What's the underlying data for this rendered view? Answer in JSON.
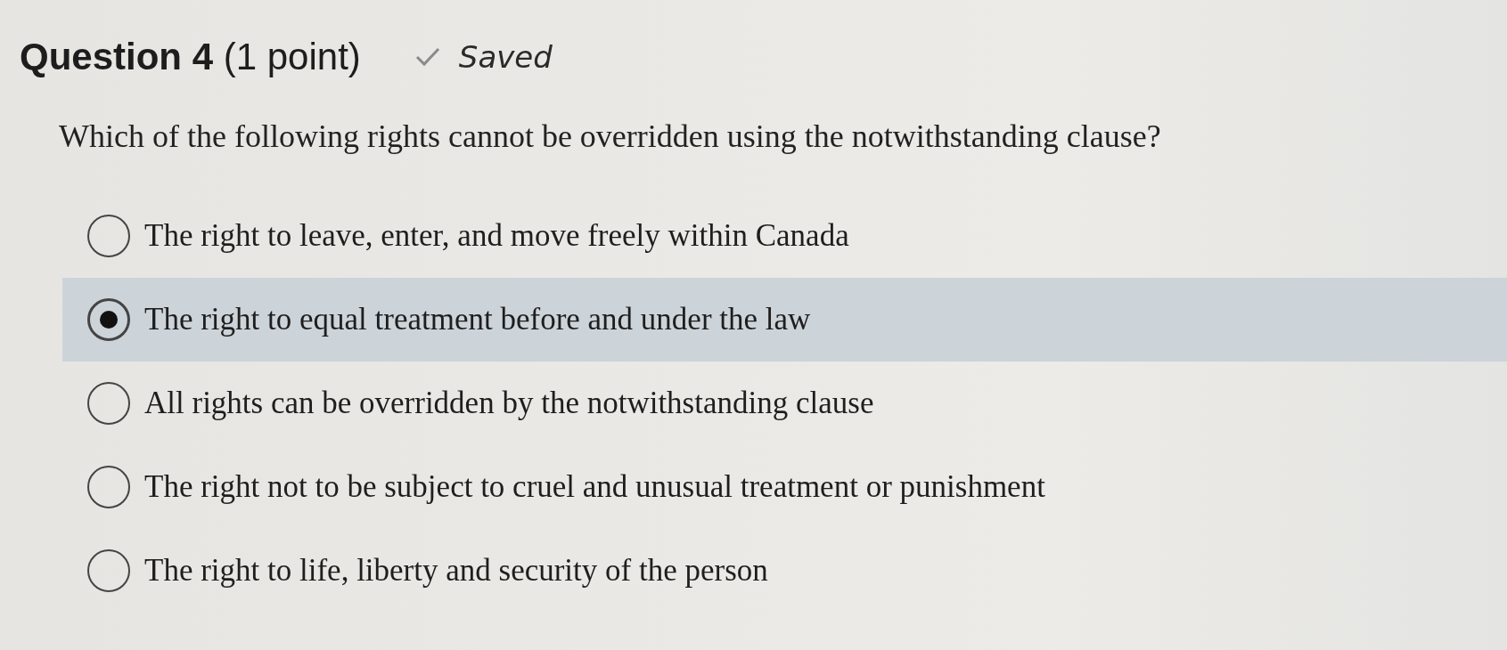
{
  "question": {
    "title": "**Question 4** (1 point)",
    "status": "Saved",
    "prompt": "Which of the following rights cannot be overridden using the notwithstanding clause?"
  },
  "options": [
    {
      "label": "The right to leave, enter, and move freely within Canada",
      "selected": false
    },
    {
      "label": "The right to equal treatment before and under the law",
      "selected": true
    },
    {
      "label": "All rights can be overridden by the notwithstanding clause",
      "selected": false
    },
    {
      "label": "The right not to be subject to cruel and unusual treatment or punishment",
      "selected": false
    },
    {
      "label": "The right to life, liberty and security of the person",
      "selected": false
    }
  ]
}
